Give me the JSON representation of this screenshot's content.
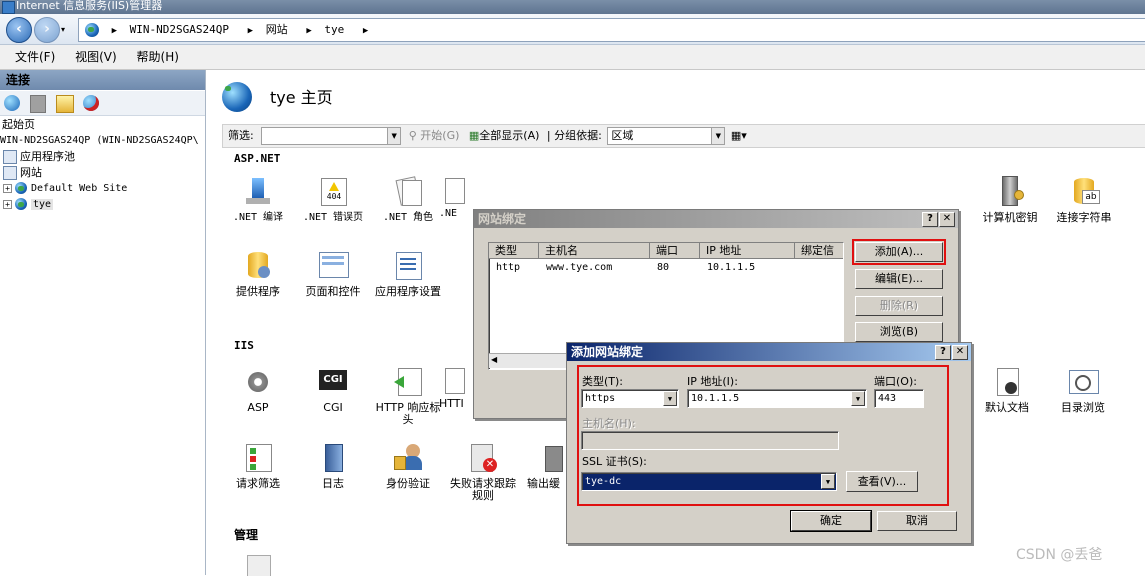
{
  "window": {
    "title": "Internet 信息服务(IIS)管理器"
  },
  "address": {
    "crumbs": [
      "WIN-ND2SGAS24QP",
      "网站",
      "tye"
    ]
  },
  "menu": {
    "items": [
      "文件(F)",
      "视图(V)",
      "帮助(H)"
    ]
  },
  "connections": {
    "header": "连接",
    "tree": {
      "start": "起始页",
      "server": "WIN-ND2SGAS24QP (WIN-ND2SGAS24QP\\",
      "apppools": "应用程序池",
      "sites": "网站",
      "default_site": "Default Web Site",
      "tye": "tye"
    }
  },
  "main": {
    "title": "tye 主页",
    "filter": {
      "label": "筛选:",
      "start": "开始(G)",
      "show_all": "全部显示(A)",
      "group_by": "分组依据:",
      "group_value": "区域"
    },
    "sections": {
      "aspnet": "ASP.NET",
      "iis": "IIS",
      "manage": "管理"
    },
    "aspnet_items": [
      ".NET 编译",
      ".NET 错误页",
      ".NET 角色",
      ".NE",
      "计算机密钥",
      "连接字符串",
      "提供程序",
      "页面和控件",
      "应用程序设置"
    ],
    "iis_items": [
      "ASP",
      "CGI",
      "HTTP 响应标头",
      "HTTI",
      "默认文档",
      "目录浏览",
      "请求筛选",
      "日志",
      "身份验证",
      "失败请求跟踪规则",
      "输出缓"
    ],
    "cgi_badge": "CGI",
    "error_badge": "404",
    "ab_badge": "ab"
  },
  "bindings_dialog": {
    "title": "网站绑定",
    "columns": [
      "类型",
      "主机名",
      "端口",
      "IP 地址",
      "绑定信"
    ],
    "rows": [
      {
        "type": "http",
        "host": "www.tye.com",
        "port": "80",
        "ip": "10.1.1.5"
      }
    ],
    "buttons": {
      "add": "添加(A)...",
      "edit": "编辑(E)...",
      "remove": "删除(R)",
      "browse": "浏览(B)"
    }
  },
  "add_dialog": {
    "title": "添加网站绑定",
    "type_label": "类型(T):",
    "type_value": "https",
    "ip_label": "IP 地址(I):",
    "ip_value": "10.1.1.5",
    "port_label": "端口(O):",
    "port_value": "443",
    "host_label": "主机名(H):",
    "host_value": "",
    "ssl_label": "SSL 证书(S):",
    "ssl_value": "tye-dc",
    "view_button": "查看(V)...",
    "ok": "确定",
    "cancel": "取消"
  },
  "watermark": "CSDN @丢爸",
  "colors": {
    "highlight": "#e01010",
    "selection": "#0a246a"
  }
}
